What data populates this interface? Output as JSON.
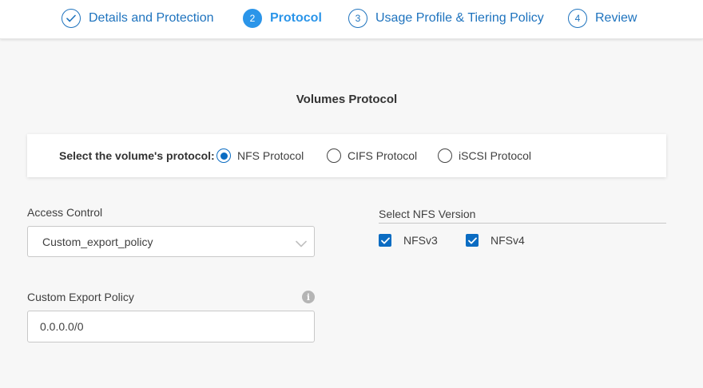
{
  "stepper": {
    "steps": [
      {
        "number": "",
        "label": "Details and Protection",
        "state": "completed",
        "icon": "check-icon"
      },
      {
        "number": "2",
        "label": "Protocol",
        "state": "active"
      },
      {
        "number": "3",
        "label": "Usage Profile & Tiering Policy",
        "state": "pending"
      },
      {
        "number": "4",
        "label": "Review",
        "state": "pending"
      }
    ]
  },
  "main": {
    "title": "Volumes Protocol",
    "protocol": {
      "prompt": "Select the volume's protocol:",
      "options": [
        {
          "label": "NFS Protocol",
          "selected": true
        },
        {
          "label": "CIFS Protocol",
          "selected": false
        },
        {
          "label": "iSCSI Protocol",
          "selected": false
        }
      ]
    },
    "access_control": {
      "label": "Access Control",
      "value": "Custom_export_policy",
      "icon": "chevron-down-icon"
    },
    "custom_export_policy": {
      "label": "Custom Export Policy",
      "value": "0.0.0.0/0",
      "info_icon": "info-icon"
    },
    "nfs_version": {
      "label": "Select NFS Version",
      "options": [
        {
          "label": "NFSv3",
          "checked": true
        },
        {
          "label": "NFSv4",
          "checked": true
        }
      ]
    }
  },
  "colors": {
    "accent": "#1e73be",
    "active_step": "#2b95e9",
    "control_blue": "#0b6cc2",
    "background": "#f7f7f7"
  }
}
